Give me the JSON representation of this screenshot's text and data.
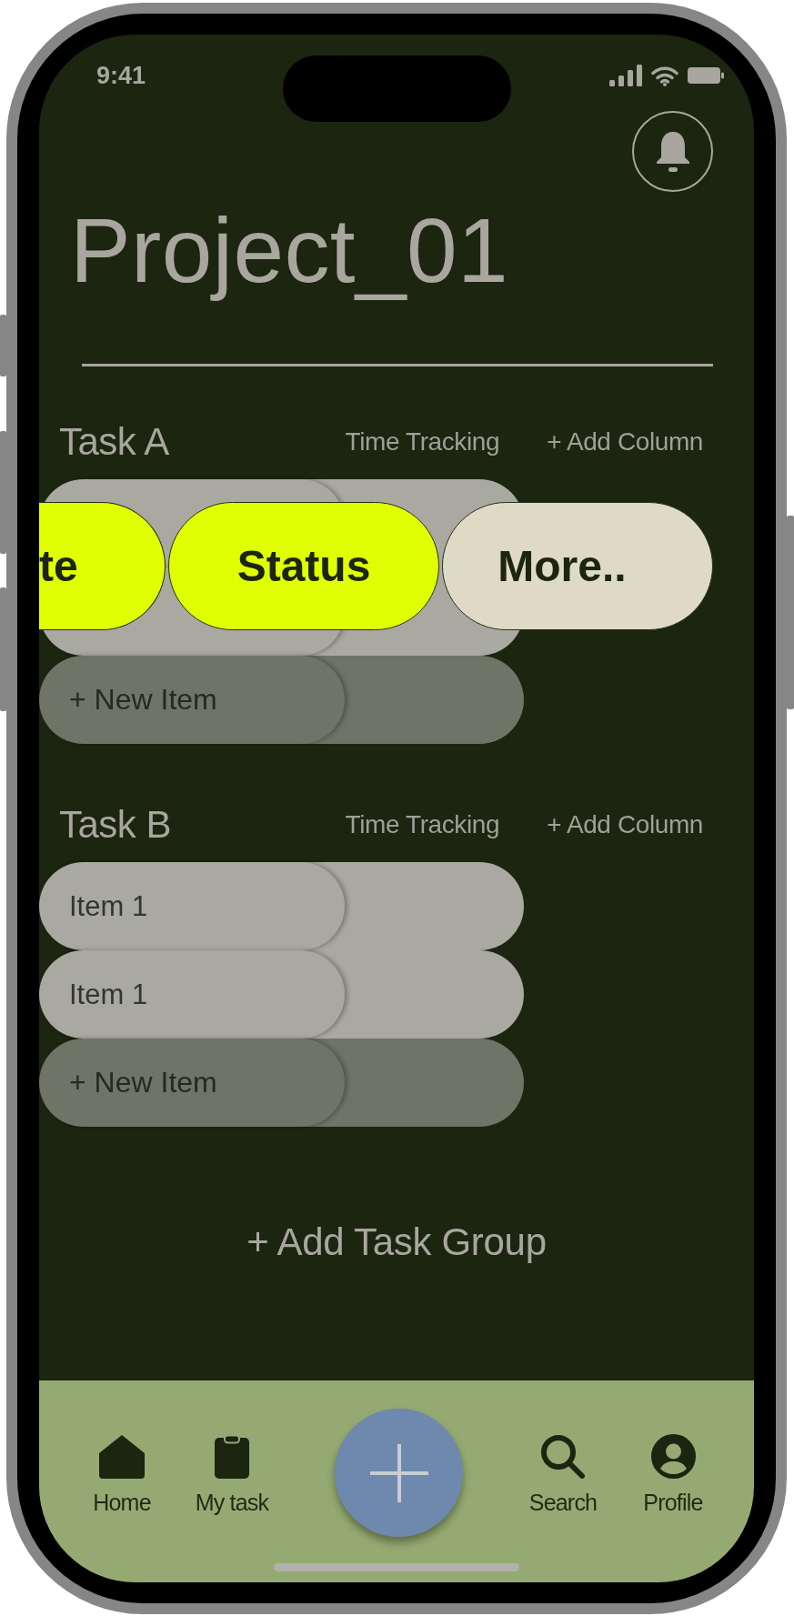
{
  "status_bar": {
    "time": "9:41"
  },
  "header": {
    "title": "Project_01"
  },
  "task_groups": [
    {
      "title": "Task A",
      "columns": [
        {
          "label": "Time Tracking"
        }
      ],
      "add_column": {
        "label": "+ Add Column"
      },
      "rows": [
        {
          "kind": "item"
        },
        {
          "kind": "item"
        },
        {
          "kind": "new",
          "label": "+ New Item"
        }
      ],
      "column_menu": [
        {
          "kind": "type",
          "label": "te"
        },
        {
          "kind": "type",
          "label": "Status"
        },
        {
          "kind": "more",
          "label": "More.."
        }
      ]
    },
    {
      "title": "Task B",
      "columns": [
        {
          "label": "Time Tracking"
        }
      ],
      "add_column": {
        "label": "+ Add Column"
      },
      "rows": [
        {
          "kind": "item",
          "label": "Item 1"
        },
        {
          "kind": "item",
          "label": "Item 1"
        },
        {
          "kind": "new",
          "label": "+ New Item"
        }
      ]
    }
  ],
  "add_group": {
    "label": "+ Add Task Group"
  },
  "tab_bar": {
    "tabs": [
      {
        "label": "Home"
      },
      {
        "label": "My task"
      },
      {
        "label": "Search"
      },
      {
        "label": "Profile"
      }
    ]
  }
}
